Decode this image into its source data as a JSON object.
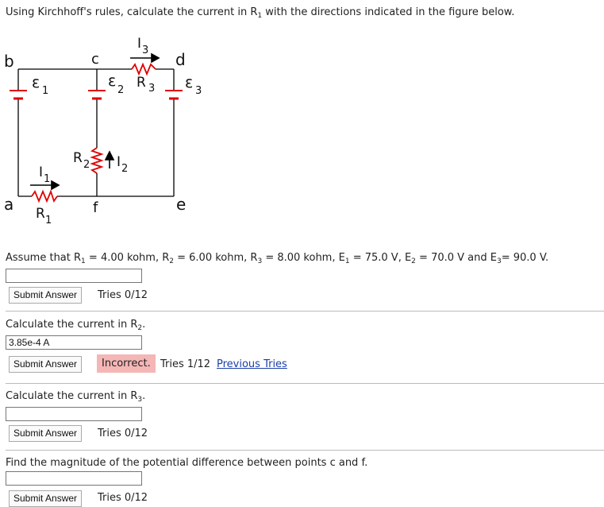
{
  "intro": {
    "text_before": "Using Kirchhoff's rules, calculate the current in R",
    "sub": "1",
    "text_after": " with the directions indicated in the figure below."
  },
  "circuit": {
    "point_b": "b",
    "point_c": "c",
    "point_d": "d",
    "point_a": "a",
    "point_f": "f",
    "point_e": "e",
    "emf1": "ε",
    "emf1_sub": "1",
    "emf2": "ε",
    "emf2_sub": "2",
    "emf3": "ε",
    "emf3_sub": "3",
    "r1": "R",
    "r1_sub": "1",
    "r2": "R",
    "r2_sub": "2",
    "r3": "R",
    "r3_sub": "3",
    "i1": "I",
    "i1_sub": "1",
    "i2": "I",
    "i2_sub": "2",
    "i3": "I",
    "i3_sub": "3",
    "wire_color": "#000000",
    "component_color": "#e00000"
  },
  "assume": {
    "t1": "Assume that R",
    "s1": "1",
    "t2": " = 4.00 kohm, R",
    "s2": "2",
    "t3": " = 6.00 kohm, R",
    "s3": "3",
    "t4": " = 8.00 kohm, E",
    "s4": "1",
    "t5": " = 75.0 V, E",
    "s5": "2",
    "t6": " = 70.0 V and E",
    "s6": "3",
    "t7": "= 90.0 V."
  },
  "questions": [
    {
      "input_value": "",
      "submit_label": "Submit Answer",
      "tries": "Tries 0/12"
    },
    {
      "prompt_before": "Calculate the current in R",
      "prompt_sub": "2",
      "prompt_after": ".",
      "input_value": "3.85e-4 A",
      "submit_label": "Submit Answer",
      "status": "Incorrect.",
      "tries": "Tries 1/12",
      "previous_tries": "Previous Tries"
    },
    {
      "prompt_before": "Calculate the current in R",
      "prompt_sub": "3",
      "prompt_after": ".",
      "input_value": "",
      "submit_label": "Submit Answer",
      "tries": "Tries 0/12"
    },
    {
      "prompt": "Find the magnitude of the potential difference between points c and f.",
      "input_value": "",
      "submit_label": "Submit Answer",
      "tries": "Tries 0/12"
    }
  ]
}
